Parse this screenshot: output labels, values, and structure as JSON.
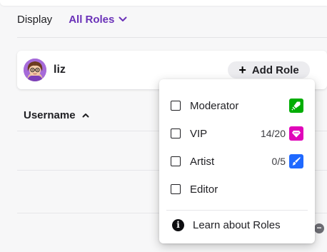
{
  "display": {
    "label": "Display",
    "filter_label": "All Roles",
    "filter_icon": "chevron-down-icon"
  },
  "user_card": {
    "username": "liz",
    "avatar_icon": "avatar",
    "add_role_label": "Add Role",
    "add_role_icon": "plus-icon"
  },
  "table": {
    "column_header": "Username",
    "sort_icon": "sort-ascending-caret-icon"
  },
  "role_menu": {
    "roles": [
      {
        "name": "Moderator",
        "count": "",
        "badge_icon": "sword-icon",
        "badge_color": "#00ad03",
        "checked": false
      },
      {
        "name": "VIP",
        "count": "14/20",
        "badge_icon": "gem-icon",
        "badge_color": "#e005b9",
        "checked": false
      },
      {
        "name": "Artist",
        "count": "0/5",
        "badge_icon": "paintbrush-icon",
        "badge_color": "#1f69ff",
        "checked": false
      },
      {
        "name": "Editor",
        "count": "",
        "badge_icon": "",
        "badge_color": "",
        "checked": false
      }
    ],
    "learn_label": "Learn about Roles",
    "learn_icon": "info-icon"
  },
  "colors": {
    "accent": "#6a31b8",
    "background": "#f7f7f8",
    "surface": "#ffffff",
    "chip": "#ececef"
  }
}
